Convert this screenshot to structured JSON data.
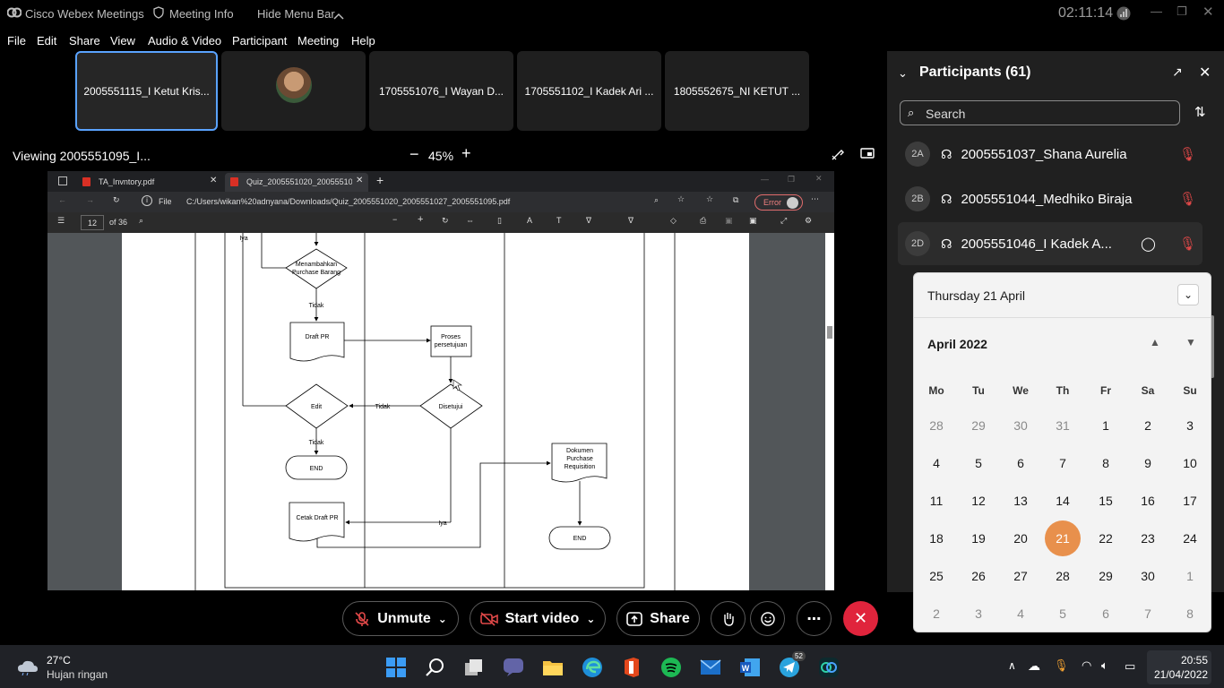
{
  "titlebar": {
    "app": "Cisco Webex Meetings",
    "meeting_info": "Meeting Info",
    "hide_menu": "Hide Menu Bar",
    "timer": "02:11:14"
  },
  "menu": [
    "File",
    "Edit",
    "Share",
    "View",
    "Audio & Video",
    "Participant",
    "Meeting",
    "Help"
  ],
  "thumbnails": [
    "2005551115_I Ketut Kris...",
    "",
    "1705551076_I Wayan D...",
    "1705551102_I Kadek Ari ...",
    "1805552675_NI KETUT ..."
  ],
  "viewing": {
    "label": "Viewing 2005551095_I...",
    "zoom": "45%"
  },
  "browser": {
    "tabs": [
      "TA_Invntory.pdf",
      "Quiz_2005551020_2005551027..."
    ],
    "address_prefix": "File",
    "address": "C:/Users/wikan%20adnyana/Downloads/Quiz_2005551020_2005551027_2005551095.pdf",
    "error_label": "Error",
    "page_num": "12",
    "page_total": "of 36"
  },
  "diagram": {
    "iya_top": "Iya",
    "add_purchase": "Menambahkan Purchase Barang",
    "tidak1": "Tidak",
    "draft_pr": "Draft PR",
    "proses": "Proses persetujuan",
    "edit": "Edit",
    "tidak2": "Tidak",
    "disetujui": "Disetujui",
    "tidak3": "Tidak",
    "end1": "END",
    "dokumen": "Dokumen Purchase Requisition",
    "cetak": "Cetak Draft PR",
    "iya2": "Iya",
    "end2": "END"
  },
  "controls": {
    "unmute": "Unmute",
    "start_video": "Start video",
    "share": "Share"
  },
  "participants": {
    "title": "Participants (61)",
    "search_placeholder": "Search",
    "rows": [
      {
        "initials": "2A",
        "name": "2005551037_Shana Aurelia"
      },
      {
        "initials": "2B",
        "name": "2005551044_Medhiko Biraja"
      },
      {
        "initials": "2D",
        "name": "2005551046_I Kadek A..."
      }
    ]
  },
  "calendar": {
    "header_date": "Thursday 21 April",
    "month": "April 2022",
    "weekdays": [
      "Mo",
      "Tu",
      "We",
      "Th",
      "Fr",
      "Sa",
      "Su"
    ],
    "weeks": [
      [
        "28",
        "29",
        "30",
        "31",
        "1",
        "2",
        "3"
      ],
      [
        "4",
        "5",
        "6",
        "7",
        "8",
        "9",
        "10"
      ],
      [
        "11",
        "12",
        "13",
        "14",
        "15",
        "16",
        "17"
      ],
      [
        "18",
        "19",
        "20",
        "21",
        "22",
        "23",
        "24"
      ],
      [
        "25",
        "26",
        "27",
        "28",
        "29",
        "30",
        "1"
      ],
      [
        "2",
        "3",
        "4",
        "5",
        "6",
        "7",
        "8"
      ]
    ],
    "selected": "21"
  },
  "taskbar": {
    "weather_temp": "27°C",
    "weather_desc": "Hujan ringan",
    "time": "20:55",
    "date": "21/04/2022",
    "telegram_badge": "52"
  }
}
